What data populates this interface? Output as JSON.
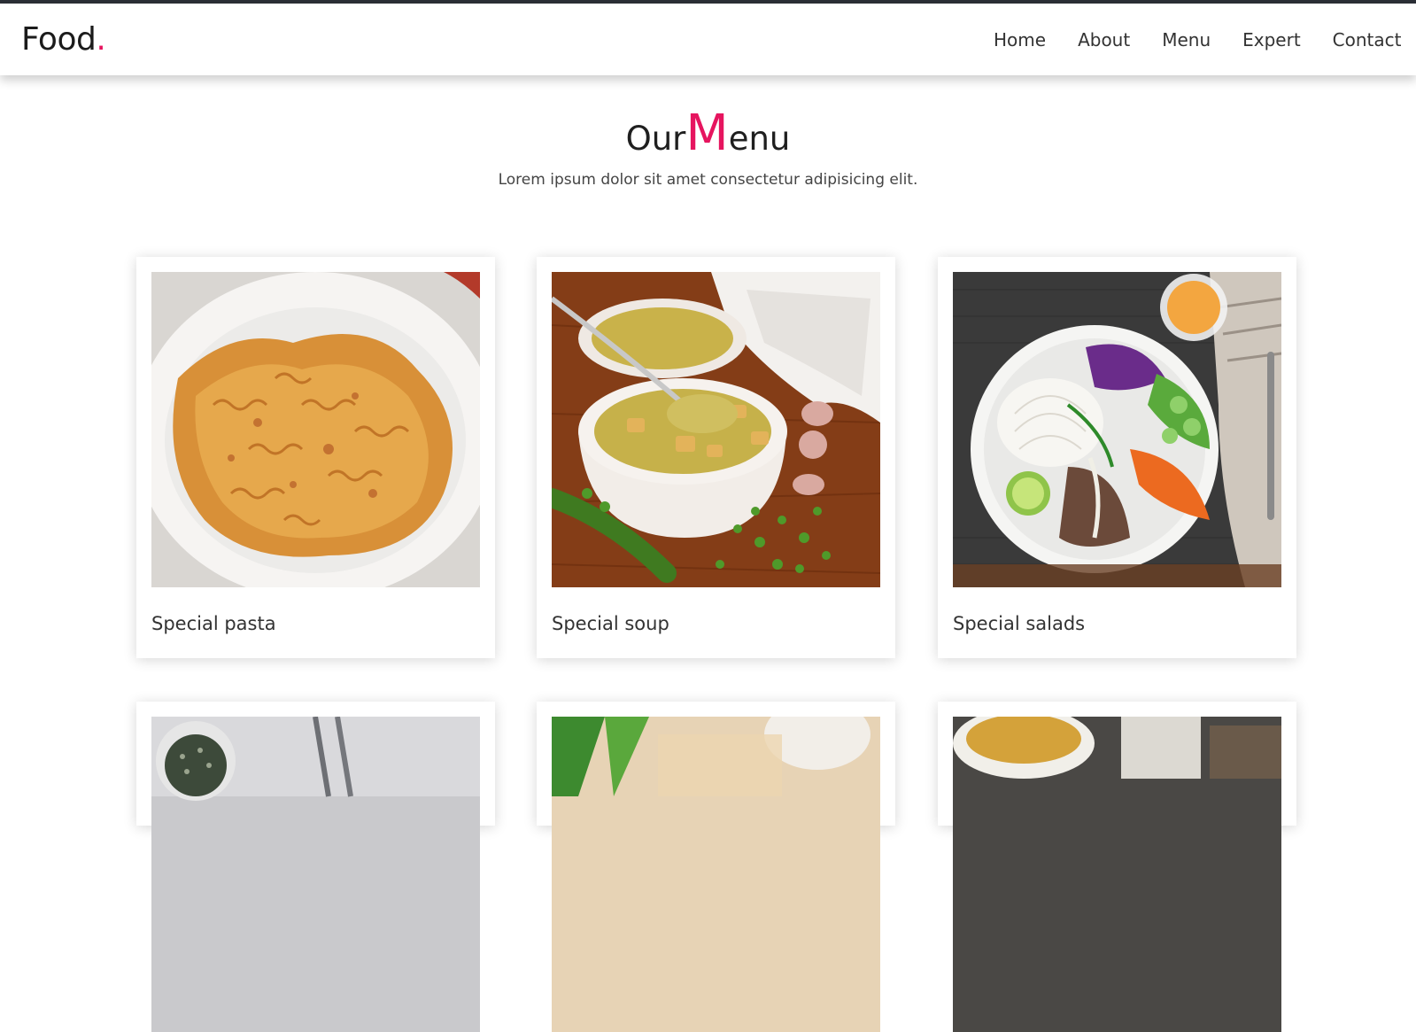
{
  "header": {
    "logo": "Food",
    "logo_dot": ".",
    "nav": [
      "Home",
      "About",
      "Menu",
      "Expert",
      "Contact"
    ]
  },
  "section": {
    "title_start": "Our",
    "title_accent": "M",
    "title_end": "enu",
    "subtitle": "Lorem ipsum dolor sit amet consectetur adipisicing elit."
  },
  "menu": {
    "items": [
      {
        "caption": "Special pasta"
      },
      {
        "caption": "Special soup"
      },
      {
        "caption": "Special salads"
      }
    ]
  },
  "colors": {
    "accent": "#e6155f",
    "text": "#1f1f1f",
    "top_strip": "#2b2f36"
  }
}
